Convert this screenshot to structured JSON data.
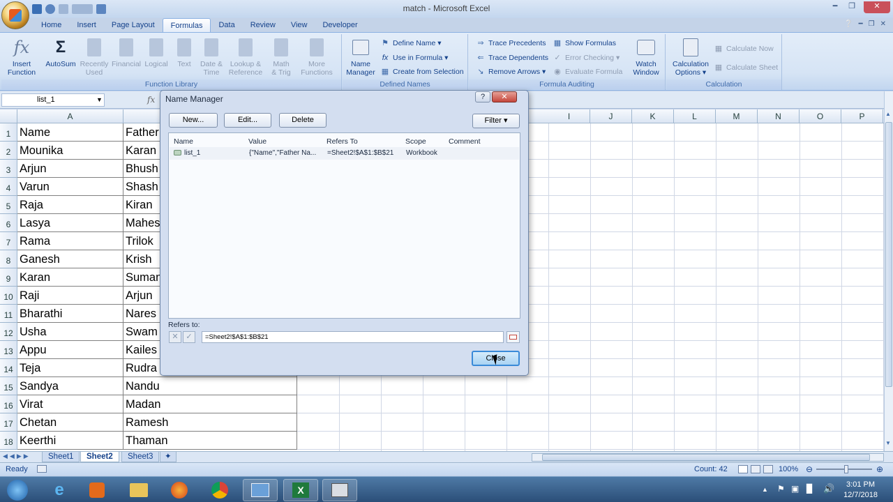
{
  "window": {
    "title": "match - Microsoft Excel"
  },
  "ribbon_tabs": [
    "Home",
    "Insert",
    "Page Layout",
    "Formulas",
    "Data",
    "Review",
    "View",
    "Developer"
  ],
  "active_tab": "Formulas",
  "function_library": {
    "label": "Function Library",
    "insert_function": [
      "Insert",
      "Function"
    ],
    "autosum": [
      "AutoSum",
      ""
    ],
    "recently_used": [
      "Recently",
      "Used"
    ],
    "financial": [
      "Financial",
      ""
    ],
    "logical": [
      "Logical",
      ""
    ],
    "text": [
      "Text",
      ""
    ],
    "date_time": [
      "Date &",
      "Time"
    ],
    "lookup": [
      "Lookup &",
      "Reference"
    ],
    "math": [
      "Math",
      "& Trig"
    ],
    "more": [
      "More",
      "Functions"
    ]
  },
  "defined_names": {
    "label": "Defined Names",
    "name_manager": [
      "Name",
      "Manager"
    ],
    "define_name": "Define Name",
    "use_in_formula": "Use in Formula",
    "create_from_selection": "Create from Selection"
  },
  "formula_auditing": {
    "label": "Formula Auditing",
    "trace_precedents": "Trace Precedents",
    "trace_dependents": "Trace Dependents",
    "remove_arrows": "Remove Arrows",
    "show_formulas": "Show Formulas",
    "error_checking": "Error Checking",
    "evaluate_formula": "Evaluate Formula",
    "watch_window": [
      "Watch",
      "Window"
    ]
  },
  "calculation": {
    "label": "Calculation",
    "options": [
      "Calculation",
      "Options"
    ],
    "calc_now": "Calculate Now",
    "calc_sheet": "Calculate Sheet"
  },
  "name_box": "list_1",
  "fx": "fx",
  "columns": [
    "A",
    "I",
    "J",
    "K",
    "L",
    "M",
    "N",
    "O",
    "P"
  ],
  "rows": [
    {
      "num": "1",
      "a": "Name",
      "b": "Father"
    },
    {
      "num": "2",
      "a": "Mounika",
      "b": "Karan"
    },
    {
      "num": "3",
      "a": "Arjun",
      "b": "Bhush"
    },
    {
      "num": "4",
      "a": "Varun",
      "b": "Shash"
    },
    {
      "num": "5",
      "a": "Raja",
      "b": "Kiran"
    },
    {
      "num": "6",
      "a": "Lasya",
      "b": "Mahes"
    },
    {
      "num": "7",
      "a": "Rama",
      "b": "Trilok"
    },
    {
      "num": "8",
      "a": "Ganesh",
      "b": "Krish"
    },
    {
      "num": "9",
      "a": "Karan",
      "b": "Suman"
    },
    {
      "num": "10",
      "a": "Raji",
      "b": "Arjun"
    },
    {
      "num": "11",
      "a": "Bharathi",
      "b": "Nares"
    },
    {
      "num": "12",
      "a": "Usha",
      "b": "Swam"
    },
    {
      "num": "13",
      "a": "Appu",
      "b": "Kailes"
    },
    {
      "num": "14",
      "a": "Teja",
      "b": "Rudra"
    },
    {
      "num": "15",
      "a": "Sandya",
      "b": "Nandu"
    },
    {
      "num": "16",
      "a": "Virat",
      "b": "Madan"
    },
    {
      "num": "17",
      "a": "Chetan",
      "b": "Ramesh"
    },
    {
      "num": "18",
      "a": "Keerthi",
      "b": "Thaman"
    }
  ],
  "sheets": [
    "Sheet1",
    "Sheet2",
    "Sheet3"
  ],
  "active_sheet": "Sheet2",
  "status": {
    "ready": "Ready",
    "count": "Count: 42",
    "zoom": "100%"
  },
  "clock": {
    "time": "3:01 PM",
    "date": "12/7/2018"
  },
  "dialog": {
    "title": "Name Manager",
    "new_btn": "New...",
    "edit_btn": "Edit...",
    "delete_btn": "Delete",
    "filter_btn": "Filter",
    "headers": [
      "Name",
      "Value",
      "Refers To",
      "Scope",
      "Comment"
    ],
    "entry": {
      "name": "list_1",
      "value": "{\"Name\",\"Father Na...",
      "refers_to": "=Sheet2!$A$1:$B$21",
      "scope": "Workbook",
      "comment": ""
    },
    "refers_label": "Refers to:",
    "refers_value": "=Sheet2!$A$1:$B$21",
    "close_btn": "Close"
  },
  "colors": {
    "ribbon": "#d6e4f5",
    "accent": "#15428b",
    "taskbar": "#2b4e78"
  }
}
